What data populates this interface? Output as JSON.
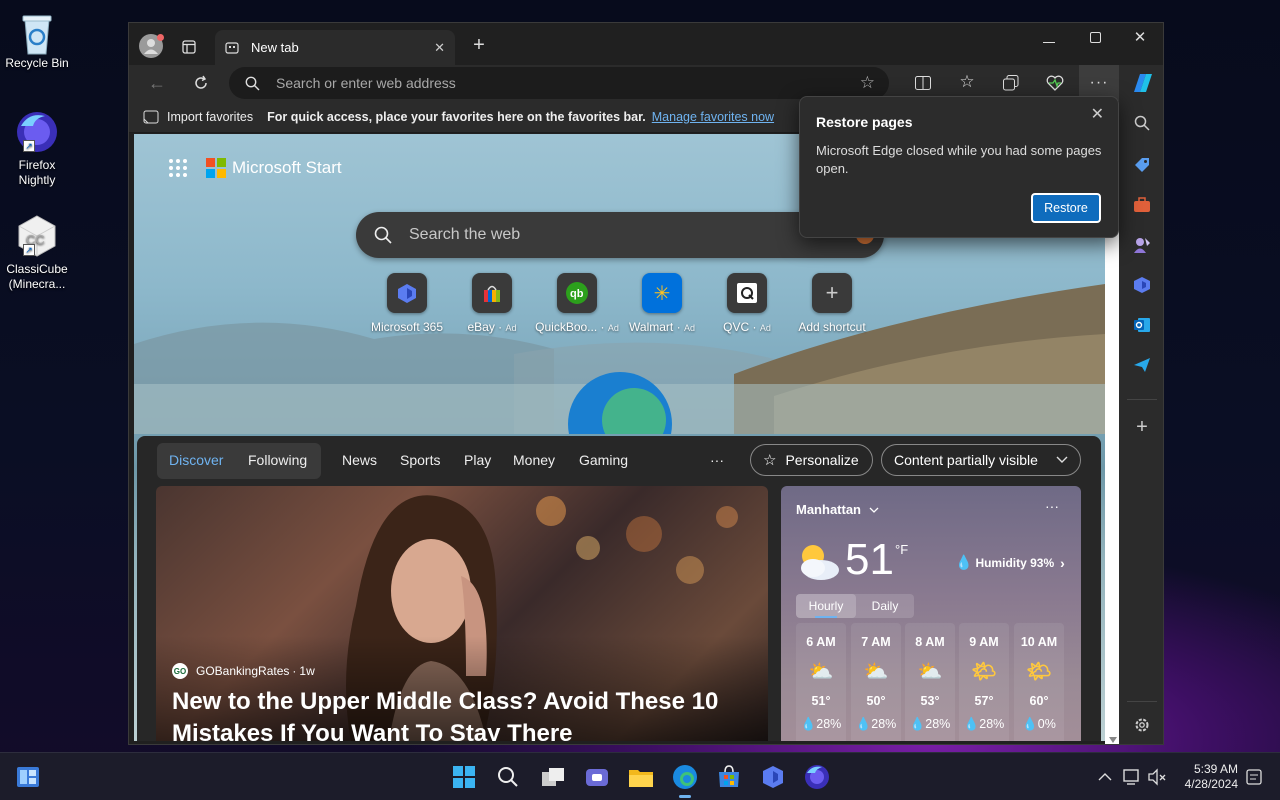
{
  "desktop": {
    "icons": [
      {
        "label": "Recycle Bin"
      },
      {
        "label": "Firefox Nightly"
      },
      {
        "label": "ClassiCube (Minecra..."
      }
    ]
  },
  "browser": {
    "tab_title": "New tab",
    "address_placeholder": "Search or enter web address",
    "favorites_bar": {
      "import_label": "Import favorites",
      "message": "For quick access, place your favorites here on the favorites bar.",
      "manage_link": "Manage favorites now"
    }
  },
  "popup": {
    "title": "Restore pages",
    "message": "Microsoft Edge closed while you had some pages open.",
    "restore_label": "Restore"
  },
  "newtab": {
    "brand": "Microsoft Start",
    "search_placeholder": "Search the web",
    "shortcuts": [
      {
        "label": "Microsoft 365",
        "ad": ""
      },
      {
        "label": "eBay",
        "ad": "Ad"
      },
      {
        "label": "QuickBoo...",
        "ad": "Ad"
      },
      {
        "label": "Walmart",
        "ad": "Ad"
      },
      {
        "label": "QVC",
        "ad": "Ad"
      },
      {
        "label": "Add shortcut",
        "ad": ""
      }
    ],
    "feed_nav": {
      "discover": "Discover",
      "following": "Following",
      "items": [
        "News",
        "Sports",
        "Play",
        "Money",
        "Gaming"
      ],
      "more": "···",
      "personalize": "Personalize",
      "content_visibility": "Content partially visible"
    },
    "article": {
      "source": "GOBankingRates",
      "age": "1w",
      "headline": "New to the Upper Middle Class? Avoid These 10 Mistakes If You Want To Stay There"
    },
    "weather": {
      "location": "Manhattan",
      "temp": "51",
      "unit": "°F",
      "humidity": "Humidity 93%",
      "tab_hourly": "Hourly",
      "tab_daily": "Daily",
      "hours": [
        {
          "time": "6 AM",
          "temp": "51°",
          "precip": "28%"
        },
        {
          "time": "7 AM",
          "temp": "50°",
          "precip": "28%"
        },
        {
          "time": "8 AM",
          "temp": "53°",
          "precip": "28%"
        },
        {
          "time": "9 AM",
          "temp": "57°",
          "precip": "28%"
        },
        {
          "time": "10 AM",
          "temp": "60°",
          "precip": "0%"
        }
      ]
    }
  },
  "taskbar": {
    "time": "5:39 AM",
    "date": "4/28/2024"
  }
}
